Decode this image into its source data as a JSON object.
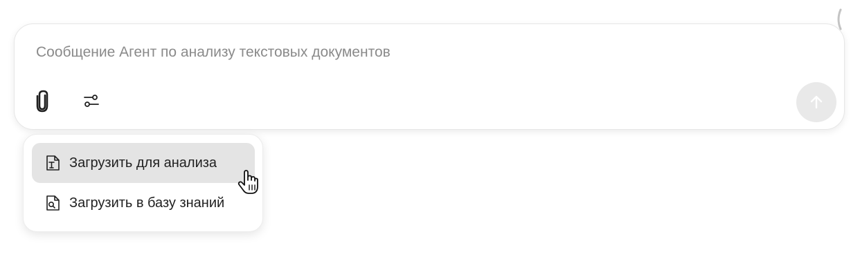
{
  "composer": {
    "placeholder": "Сообщение Агент по анализу текстовых документов",
    "value": "",
    "attach_icon": "paperclip-icon",
    "settings_icon": "sliders-icon",
    "send_icon": "arrow-up-icon",
    "send_disabled": true
  },
  "menu": {
    "items": [
      {
        "label": "Загрузить для анализа",
        "icon": "text-file-icon",
        "highlighted": true
      },
      {
        "label": "Загрузить в базу знаний",
        "icon": "search-file-icon",
        "highlighted": false
      }
    ]
  },
  "colors": {
    "menu_highlight": "#e4e4e4",
    "send_button_bg": "#e9e9e9",
    "placeholder_text": "#8a8a8a"
  }
}
